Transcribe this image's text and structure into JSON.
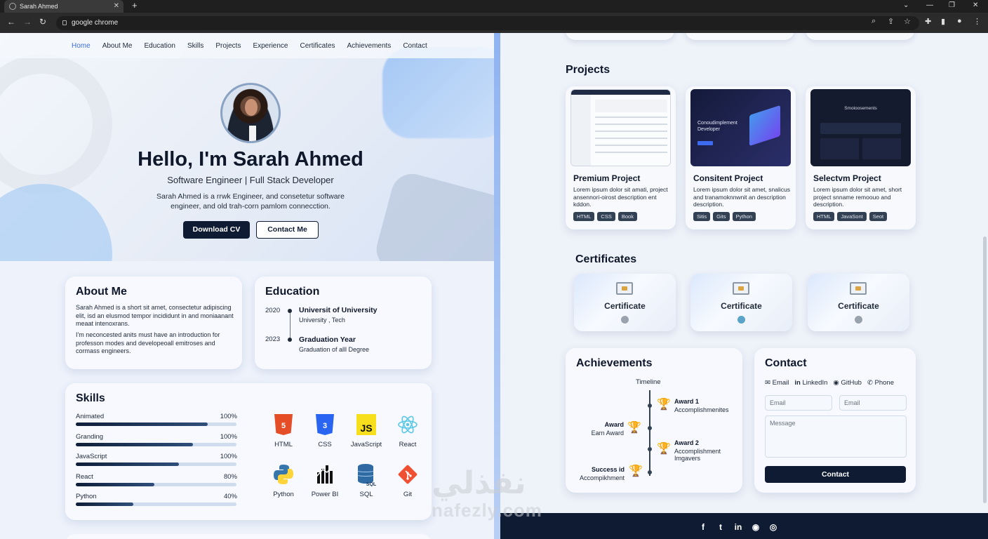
{
  "browser": {
    "tab_title": "Sarah Ahmed",
    "address": "google chrome"
  },
  "nav": [
    "Home",
    "About Me",
    "Education",
    "Skills",
    "Projects",
    "Experience",
    "Certificates",
    "Achievements",
    "Contact"
  ],
  "hero": {
    "heading": "Hello, I'm Sarah Ahmed",
    "role": "Software Engineer | Full Stack Developer",
    "intro": "Sarah Ahmed is a rrwk Engineer, and consetetur software engineer, and old trah-corn pamlom connecction.",
    "download": "Download CV",
    "contact": "Contact Me"
  },
  "about": {
    "title": "About Me",
    "p1": "Sarah Ahmed is a short sit amet, consectetur adipiscing elit, isd an elusmod tempor incididunt in and moniaanant meaat intenoxrans.",
    "p2": "I'm neconcested anits must have an introduction for professon modes and developeoall emitroses and cormass engineers."
  },
  "education": {
    "title": "Education",
    "items": [
      {
        "year": "2020",
        "title": "Universit of University",
        "sub": "University , Tech"
      },
      {
        "year": "2023",
        "title": "Graduation Year",
        "sub": "Graduation of alll Degree"
      }
    ]
  },
  "skills": {
    "title": "Skills",
    "bars": [
      {
        "name": "Animated",
        "label": "100%",
        "level": 0.82
      },
      {
        "name": "Granding",
        "label": "100%",
        "level": 0.73
      },
      {
        "name": "JavaScript",
        "label": "100%",
        "level": 0.64
      },
      {
        "name": "React",
        "label": "80%",
        "level": 0.49
      },
      {
        "name": "Python",
        "label": "40%",
        "level": 0.36
      }
    ],
    "tech": [
      "HTML",
      "CSS",
      "JavaScript",
      "React",
      "Python",
      "Power BI",
      "SQL",
      "Git"
    ]
  },
  "projects": {
    "title": "Projects",
    "items": [
      {
        "title": "Premium Project",
        "desc": "Lorem ipsum dolor sit amati, project ansennori-oirost description ent kddon.",
        "tags": [
          "HTML",
          "CSS",
          "Book"
        ]
      },
      {
        "title": "Consitent Project",
        "desc": "Lorem ipsum dolor sit amet, snalicus and tranamoknnwnit an description description.",
        "tags": [
          "Sitis",
          "Gits",
          "Python"
        ]
      },
      {
        "title": "Selectvm Project",
        "desc": "Lorem ipsum dolor sit amet, short project snname remoouo and description.",
        "tags": [
          "HTML",
          "JavaSont",
          "Seot"
        ]
      }
    ],
    "shot_texts": [
      "Conoudimplement Developer",
      "Smoloosements"
    ]
  },
  "certificates": {
    "title": "Certificates",
    "items": [
      "Certificate",
      "Certificate",
      "Certificate"
    ],
    "medal_colors": [
      "#9aa3ad",
      "#5aa3c9",
      "#9aa3ad"
    ]
  },
  "achievements": {
    "title": "Achievements",
    "timeline_label": "Timeline",
    "items": [
      {
        "title": "Award 1",
        "sub": "Accomplishmenites"
      },
      {
        "title": "Award",
        "sub": "Earn Award"
      },
      {
        "title": "Award 2",
        "sub": "Accomplishment Imgavers"
      },
      {
        "title": "Success id",
        "sub": "Accompikhment"
      }
    ]
  },
  "contact": {
    "title": "Contact",
    "links": [
      "Email",
      "LinkedIn",
      "GitHub",
      "Phone"
    ],
    "email_ph1": "Email",
    "email_ph2": "Email",
    "message_ph": "Message",
    "send": "Contact"
  },
  "footer": {
    "icons": [
      "facebook-icon",
      "twitter-icon",
      "linkedin-icon",
      "github-icon",
      "instagram-icon"
    ]
  },
  "watermark": {
    "arabic": "نفذلي",
    "latin": "nafezly.com"
  }
}
